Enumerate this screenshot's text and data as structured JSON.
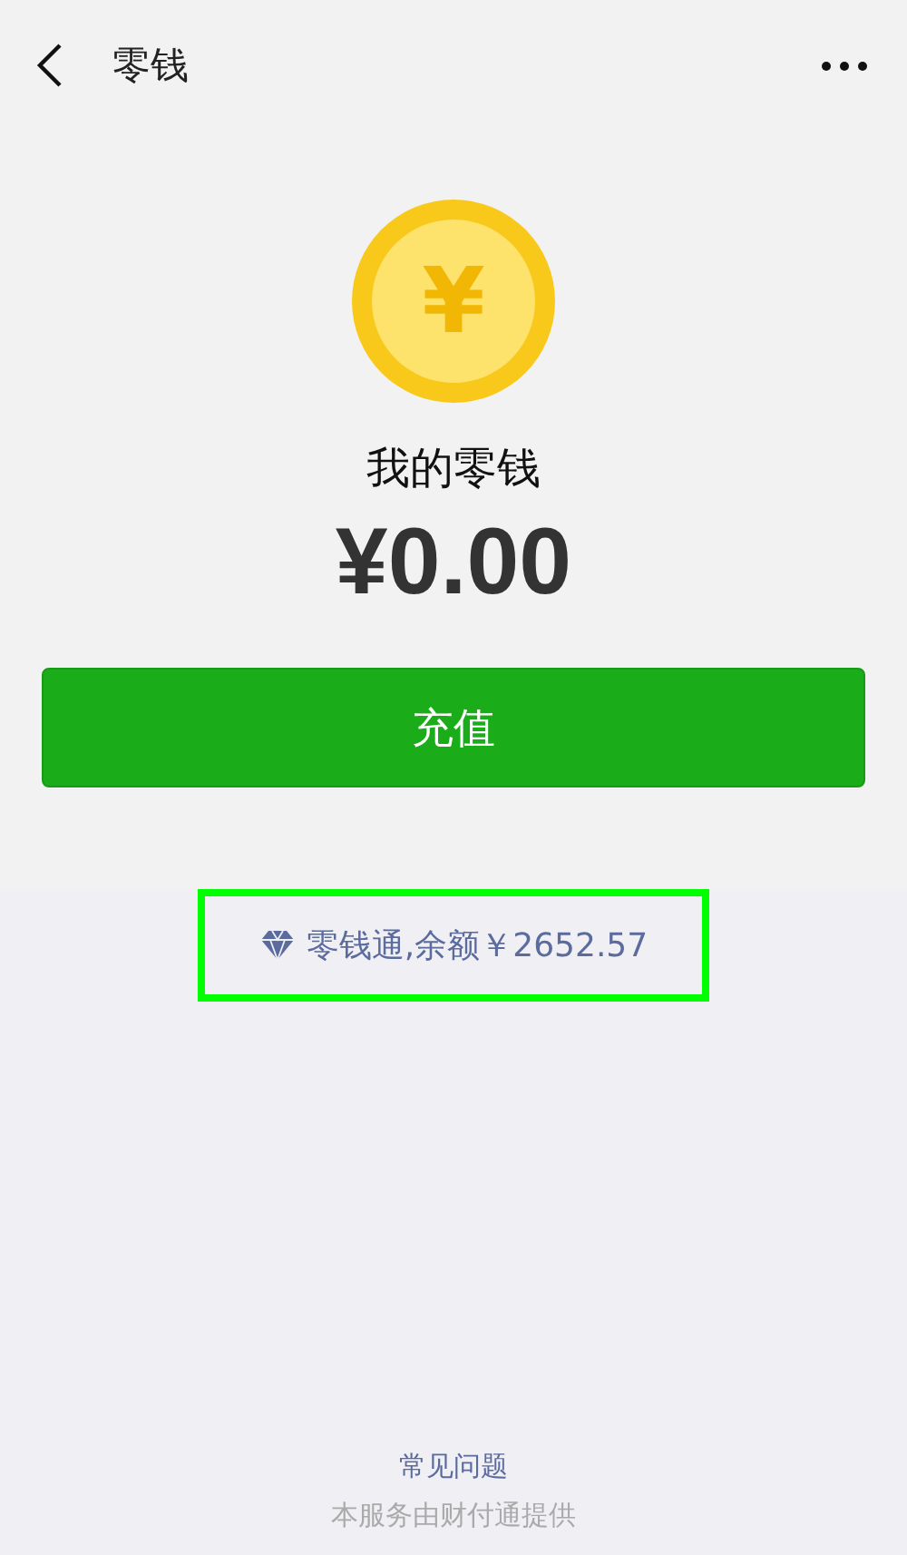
{
  "nav": {
    "title": "零钱"
  },
  "coin": {
    "symbol": "¥"
  },
  "balance": {
    "label": "我的零钱",
    "amount": "¥0.00"
  },
  "recharge_button": "充值",
  "fund_link": {
    "text": "零钱通,余额￥2652.57",
    "highlighted": true
  },
  "footer": {
    "faq": "常见问题",
    "provider": "本服务由财付通提供"
  }
}
